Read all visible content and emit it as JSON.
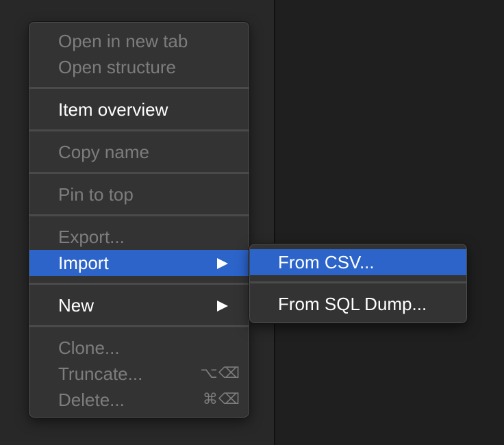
{
  "context_menu": {
    "items": [
      {
        "label": "Open in new tab",
        "enabled": false
      },
      {
        "label": "Open structure",
        "enabled": false
      },
      {
        "label": "Item overview",
        "enabled": true
      },
      {
        "label": "Copy name",
        "enabled": false
      },
      {
        "label": "Pin to top",
        "enabled": false
      },
      {
        "label": "Export...",
        "enabled": false
      },
      {
        "label": "Import",
        "enabled": true,
        "highlighted": true,
        "has_submenu": true
      },
      {
        "label": "New",
        "enabled": true,
        "has_submenu": true
      },
      {
        "label": "Clone...",
        "enabled": false
      },
      {
        "label": "Truncate...",
        "enabled": false,
        "shortcut": "⌥⌫"
      },
      {
        "label": "Delete...",
        "enabled": false,
        "shortcut": "⌘⌫"
      }
    ]
  },
  "import_submenu": {
    "items": [
      {
        "label": "From CSV...",
        "highlighted": true
      },
      {
        "label": "From SQL Dump..."
      }
    ]
  },
  "colors": {
    "highlight": "#2c64c9",
    "menu_background": "#333333",
    "disabled_text": "#7d7d7d"
  }
}
